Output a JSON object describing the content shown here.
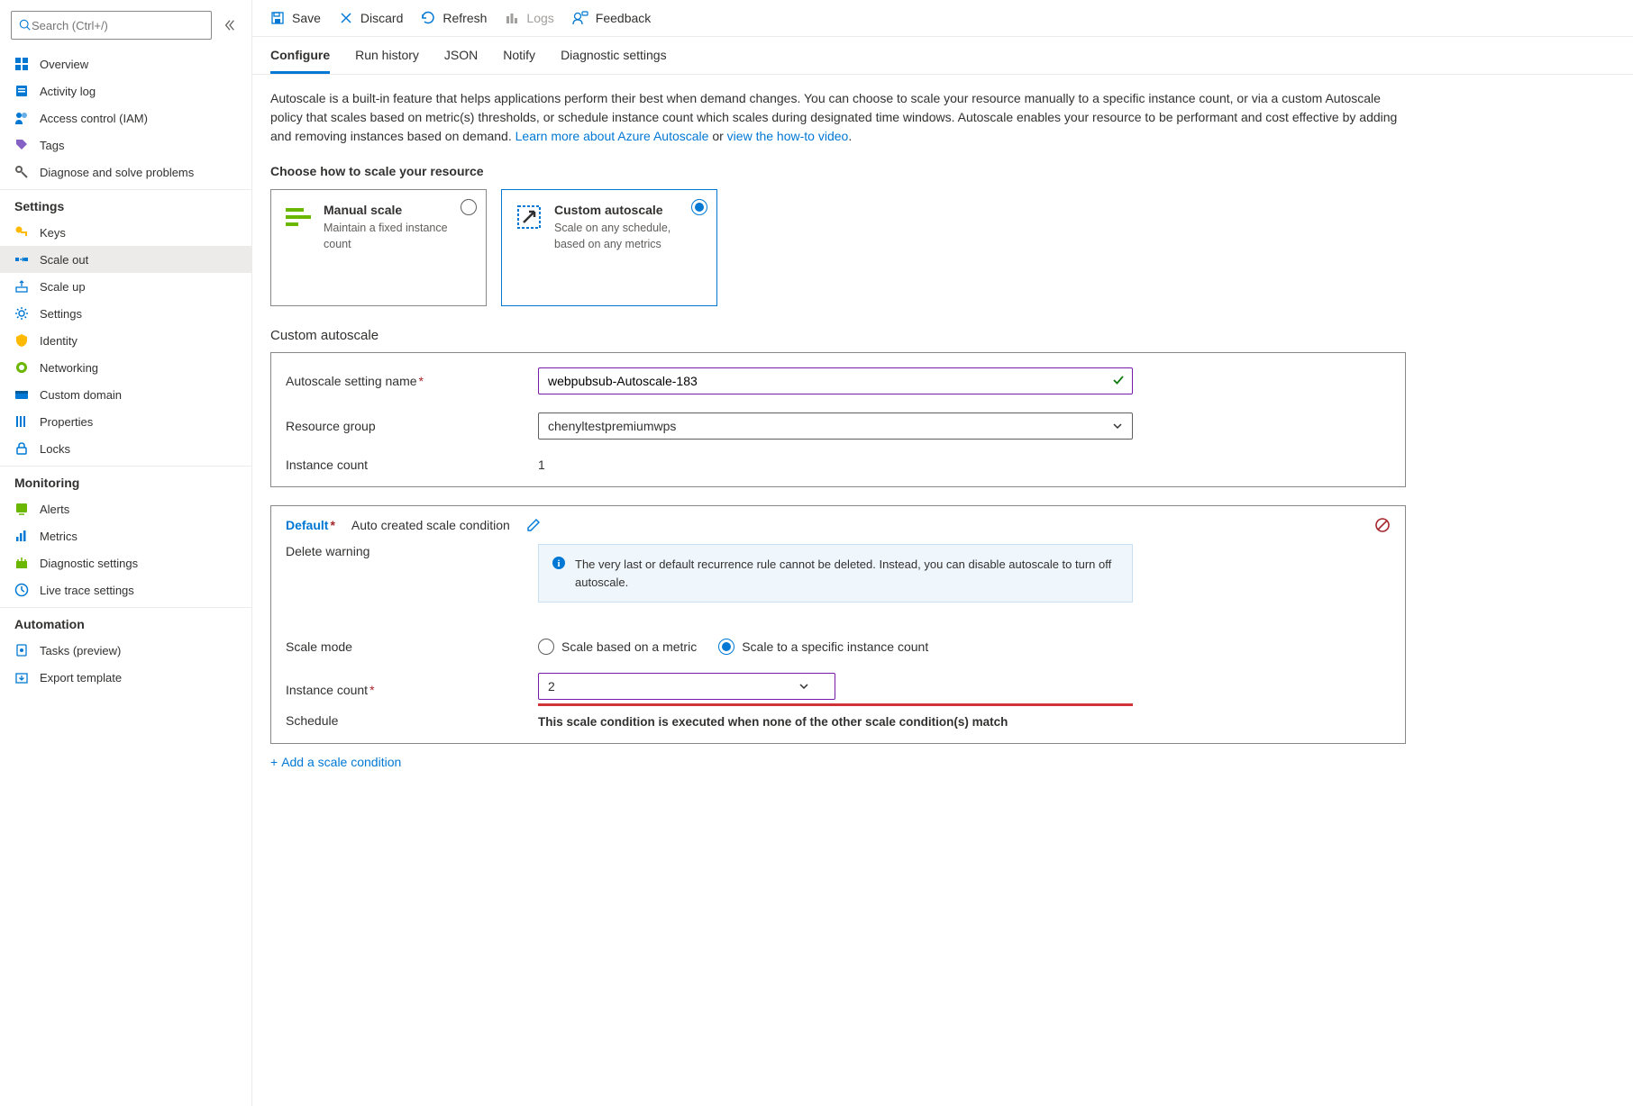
{
  "search": {
    "placeholder": "Search (Ctrl+/)"
  },
  "sidebar": {
    "items_top": [
      {
        "label": "Overview",
        "icon": "overview"
      },
      {
        "label": "Activity log",
        "icon": "activity-log"
      },
      {
        "label": "Access control (IAM)",
        "icon": "access-control"
      },
      {
        "label": "Tags",
        "icon": "tags"
      },
      {
        "label": "Diagnose and solve problems",
        "icon": "diagnose"
      }
    ],
    "section_settings": "Settings",
    "items_settings": [
      {
        "label": "Keys",
        "icon": "keys"
      },
      {
        "label": "Scale out",
        "icon": "scale-out",
        "active": true
      },
      {
        "label": "Scale up",
        "icon": "scale-up"
      },
      {
        "label": "Settings",
        "icon": "settings"
      },
      {
        "label": "Identity",
        "icon": "identity"
      },
      {
        "label": "Networking",
        "icon": "networking"
      },
      {
        "label": "Custom domain",
        "icon": "custom-domain"
      },
      {
        "label": "Properties",
        "icon": "properties"
      },
      {
        "label": "Locks",
        "icon": "locks"
      }
    ],
    "section_monitoring": "Monitoring",
    "items_monitoring": [
      {
        "label": "Alerts",
        "icon": "alerts"
      },
      {
        "label": "Metrics",
        "icon": "metrics"
      },
      {
        "label": "Diagnostic settings",
        "icon": "diagnostic"
      },
      {
        "label": "Live trace settings",
        "icon": "live-trace"
      }
    ],
    "section_automation": "Automation",
    "items_automation": [
      {
        "label": "Tasks (preview)",
        "icon": "tasks"
      },
      {
        "label": "Export template",
        "icon": "export"
      }
    ]
  },
  "toolbar": {
    "save": "Save",
    "discard": "Discard",
    "refresh": "Refresh",
    "logs": "Logs",
    "feedback": "Feedback"
  },
  "tabs": [
    {
      "label": "Configure",
      "active": true
    },
    {
      "label": "Run history"
    },
    {
      "label": "JSON"
    },
    {
      "label": "Notify"
    },
    {
      "label": "Diagnostic settings"
    }
  ],
  "description": {
    "text1": "Autoscale is a built-in feature that helps applications perform their best when demand changes. You can choose to scale your resource manually to a specific instance count, or via a custom Autoscale policy that scales based on metric(s) thresholds, or schedule instance count which scales during designated time windows. Autoscale enables your resource to be performant and cost effective by adding and removing instances based on demand. ",
    "link1": "Learn more about Azure Autoscale",
    "or": " or ",
    "link2": "view the how-to video",
    "dot": "."
  },
  "choose_title": "Choose how to scale your resource",
  "scale_cards": {
    "manual": {
      "title": "Manual scale",
      "sub": "Maintain a fixed instance count"
    },
    "custom": {
      "title": "Custom autoscale",
      "sub": "Scale on any schedule, based on any metrics"
    }
  },
  "custom_section": {
    "title": "Custom autoscale",
    "name_label": "Autoscale setting name",
    "name_value": "webpubsub-Autoscale-183",
    "rg_label": "Resource group",
    "rg_value": "chenyltestpremiumwps",
    "instance_label": "Instance count",
    "instance_value": "1"
  },
  "condition": {
    "name": "Default",
    "sub": "Auto created scale condition",
    "delete_label": "Delete warning",
    "info": "The very last or default recurrence rule cannot be deleted. Instead, you can disable autoscale to turn off autoscale.",
    "scale_mode_label": "Scale mode",
    "mode_metric": "Scale based on a metric",
    "mode_count": "Scale to a specific instance count",
    "instance_label": "Instance count",
    "instance_value": "2",
    "schedule_label": "Schedule",
    "schedule_note": "This scale condition is executed when none of the other scale condition(s) match"
  },
  "add_condition": "Add a scale condition"
}
